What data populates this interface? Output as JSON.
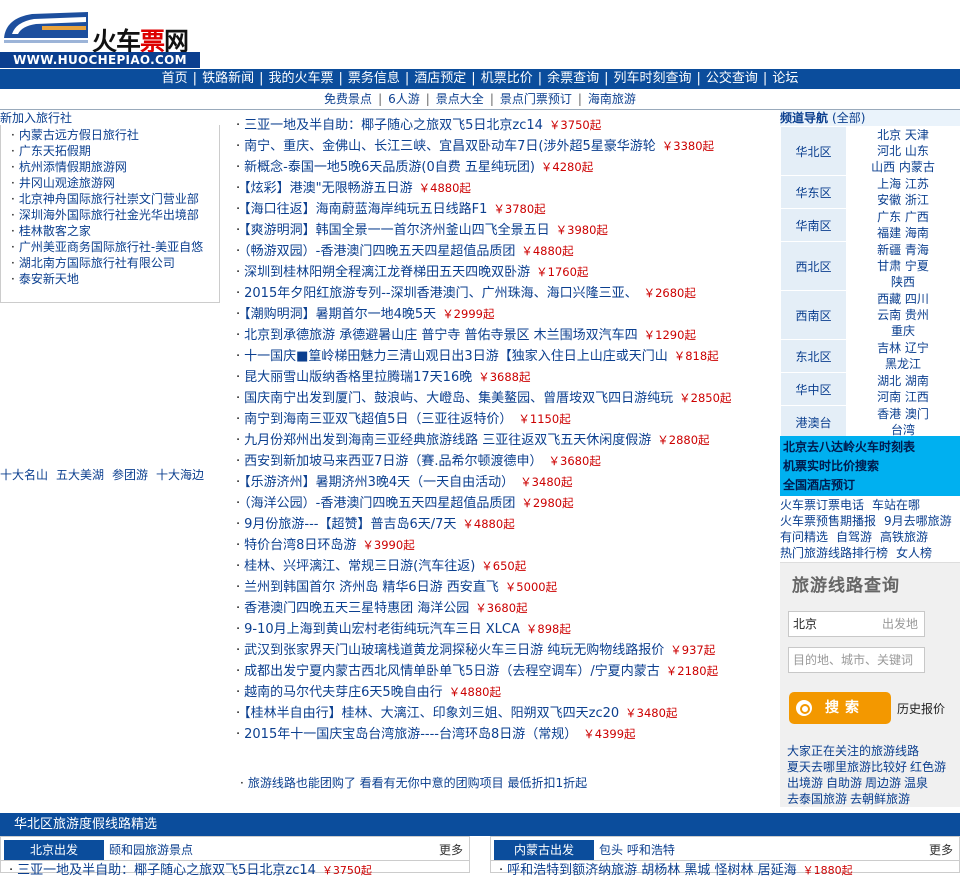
{
  "logo": {
    "brand_part1": "火车",
    "brand_part2": "票",
    "brand_part3": "网",
    "url": "WWW.HUOCHEPIAO.COM"
  },
  "main_nav": [
    "首页",
    "铁路新闻",
    "我的火车票",
    "票务信息",
    "酒店预定",
    "机票比价",
    "余票查询",
    "列车时刻查询",
    "公交查询",
    "论坛"
  ],
  "sub_nav": [
    "免费景点",
    "6人游",
    "景点大全",
    "景点门票预订",
    "海南旅游"
  ],
  "agencies": {
    "title": "新加入旅行社",
    "items": [
      "内蒙古远方假日旅行社",
      "广东天拓假期",
      "杭州添情假期旅游网",
      "井冈山观途旅游网",
      "北京神舟国际旅行社崇文门营业部",
      "深圳海外国际旅行社金光华出境部",
      "桂林散客之家",
      "广州美亚商务国际旅行社-美亚自悠",
      "湖北南方国际旅行社有限公司",
      "泰安新天地"
    ]
  },
  "famous": [
    "十大名山",
    "五大美湖",
    "参团游",
    "十大海边"
  ],
  "routes": [
    {
      "title": "三亚一地及半自助：椰子随心之旅双飞5日北京zc14",
      "price": "￥3750起"
    },
    {
      "title": "南宁、重庆、金佛山、长江三峡、宜昌双卧动车7日(涉外超5星豪华游轮",
      "price": "￥3380起"
    },
    {
      "title": "新概念-泰国一地5晚6天品质游(0自费 五星纯玩团)",
      "price": "￥4280起"
    },
    {
      "title": "【炫彩】港澳\"无限畅游五日游",
      "price": "￥4880起"
    },
    {
      "title": "【海口往返】海南蔚蓝海岸纯玩五日线路F1",
      "price": "￥3780起"
    },
    {
      "title": "【爽游明洞】韩国全景一一首尔济州釜山四飞全景五日",
      "price": "￥3980起"
    },
    {
      "title": "（畅游双园）-香港澳门四晚五天四星超值品质团",
      "price": "￥4880起"
    },
    {
      "title": "深圳到桂林阳朔全程漓江龙脊梯田五天四晚双卧游",
      "price": "￥1760起"
    },
    {
      "title": "2015年夕阳红旅游专列--深圳香港澳门、广州珠海、海口兴隆三亚、",
      "price": "￥2680起"
    },
    {
      "title": "【潮购明洞】暑期首尔一地4晚5天",
      "price": "￥2999起"
    },
    {
      "title": "北京到承德旅游 承德避暑山庄 普宁寺 普佑寺景区 木兰围场双汽车四",
      "price": "￥1290起"
    },
    {
      "title": "十一国庆■篁岭梯田魅力三清山观日出3日游【独家入住日上山庄或天门山",
      "price": "￥818起"
    },
    {
      "title": "昆大丽雪山版纳香格里拉腾瑞17天16晚",
      "price": "￥3688起"
    },
    {
      "title": "国庆南宁出发到厦门、鼓浪屿、大嶝岛、集美鳌园、曾厝垵双飞四日游纯玩",
      "price": "￥2850起",
      "wrap": true
    },
    {
      "title": "南宁到海南三亚双飞超值5日（三亚往返特价）",
      "price": "￥1150起"
    },
    {
      "title": "九月份郑州出发到海南三亚经典旅游线路 三亚往返双飞五天休闲度假游",
      "price": "￥2880起"
    },
    {
      "title": "西安到新加坡马来西亚7日游（賽.品希尔顿渡德申）",
      "price": "￥3680起"
    },
    {
      "title": "【乐游济州】暑期济州3晚4天（一天自由活动）",
      "price": "￥3480起"
    },
    {
      "title": "（海洋公园）-香港澳门四晚五天四星超值品质团",
      "price": "￥2980起"
    },
    {
      "title": "9月份旅游---【超赞】普吉岛6天/7天",
      "price": "￥4880起"
    },
    {
      "title": "特价台湾8日环岛游",
      "price": "￥3990起"
    },
    {
      "title": "桂林、兴坪漓江、常规三日游(汽车往返)",
      "price": "￥650起"
    },
    {
      "title": "兰州到韩国首尔 济州岛 精华6日游 西安直飞",
      "price": "￥5000起"
    },
    {
      "title": "香港澳门四晚五天三星特惠团 海洋公园",
      "price": "￥3680起"
    },
    {
      "title": "9-10月上海到黄山宏村老街纯玩汽车三日 XLCA",
      "price": "￥898起"
    },
    {
      "title": "武汉到张家界天门山玻璃栈道黄龙洞探秘火车三日游 纯玩无购物线路报价",
      "price": "￥937起"
    },
    {
      "title": "成都出发宁夏内蒙古西北风情单卧单飞5日游（去程空调车）/宁夏内蒙古",
      "price": "￥2180起"
    },
    {
      "title": "越南的马尔代夫芽庄6天5晚自由行",
      "price": "￥4880起"
    },
    {
      "title": "【桂林半自由行】桂林、大漓江、印象刘三姐、阳朔双飞四天zc20",
      "price": "￥3480起"
    },
    {
      "title": "2015年十一国庆宝岛台湾旅游----台湾环岛8日游（常规）",
      "price": "￥4399起"
    }
  ],
  "route_footer": "旅游线路也能团购了 看看有无你中意的团购项目 最低折扣1折起",
  "channel": {
    "title": "频道导航",
    "all": "(全部)",
    "regions": [
      {
        "name": "华北区",
        "provinces": [
          "北京 天津",
          "河北 山东",
          "山西 内蒙古"
        ]
      },
      {
        "name": "华东区",
        "provinces": [
          "上海 江苏",
          "安徽 浙江"
        ]
      },
      {
        "name": "华南区",
        "provinces": [
          "广东 广西",
          "福建 海南"
        ]
      },
      {
        "name": "西北区",
        "provinces": [
          "新疆 青海",
          "甘肃 宁夏",
          "陕西"
        ]
      },
      {
        "name": "西南区",
        "provinces": [
          "西藏 四川",
          "云南 贵州",
          "重庆"
        ]
      },
      {
        "name": "东北区",
        "provinces": [
          "吉林 辽宁",
          "黑龙江"
        ]
      },
      {
        "name": "华中区",
        "provinces": [
          "湖北 湖南",
          "河南 江西"
        ]
      },
      {
        "name": "港澳台",
        "provinces": [
          "香港 澳门",
          "台湾"
        ]
      }
    ]
  },
  "blue_links": [
    "北京去八达岭火车时刻表",
    "机票实时比价搜索",
    "全国酒店预订"
  ],
  "misc_links": [
    [
      "火车票订票电话",
      "车站在哪"
    ],
    [
      "火车票预售期播报",
      "9月去哪旅游"
    ],
    [
      "有问精选",
      "自驾游",
      "高铁旅游"
    ],
    [
      "热门旅游线路排行榜",
      "女人榜"
    ]
  ],
  "search": {
    "title": "旅游线路查询",
    "from_value": "北京",
    "from_placeholder": "出发地",
    "to_placeholder": "目的地、城市、关键词",
    "button": "搜索",
    "history": "历史报价"
  },
  "hot_links": [
    [
      "大家正在关注的旅游线路"
    ],
    [
      "夏天去哪里旅游比较好",
      "红色游"
    ],
    [
      "出境游",
      "自助游",
      "周边游",
      "温泉"
    ],
    [
      "去泰国旅游",
      "去朝鲜旅游"
    ]
  ],
  "section": {
    "title": "华北区旅游度假线路精选",
    "left_tab": "北京出发",
    "left_other": "颐和园旅游景点",
    "left_more": "更多",
    "left_row": "三亚一地及半自助：椰子随心之旅双飞5日北京zc14",
    "left_row_price": "￥3750起",
    "right_tab": "内蒙古出发",
    "right_other": "包头 呼和浩特",
    "right_more": "更多",
    "right_row": "呼和浩特到额济纳旅游 胡杨林 黑城 怪树林 居延海",
    "right_row_price": "￥1880起"
  },
  "colors": {
    "nav_blue": "#0b4d9c",
    "price_red": "#cc0000",
    "link_blue": "#0b3f8f",
    "search_orange": "#f39800",
    "highlight_cyan": "#00b0f0"
  }
}
